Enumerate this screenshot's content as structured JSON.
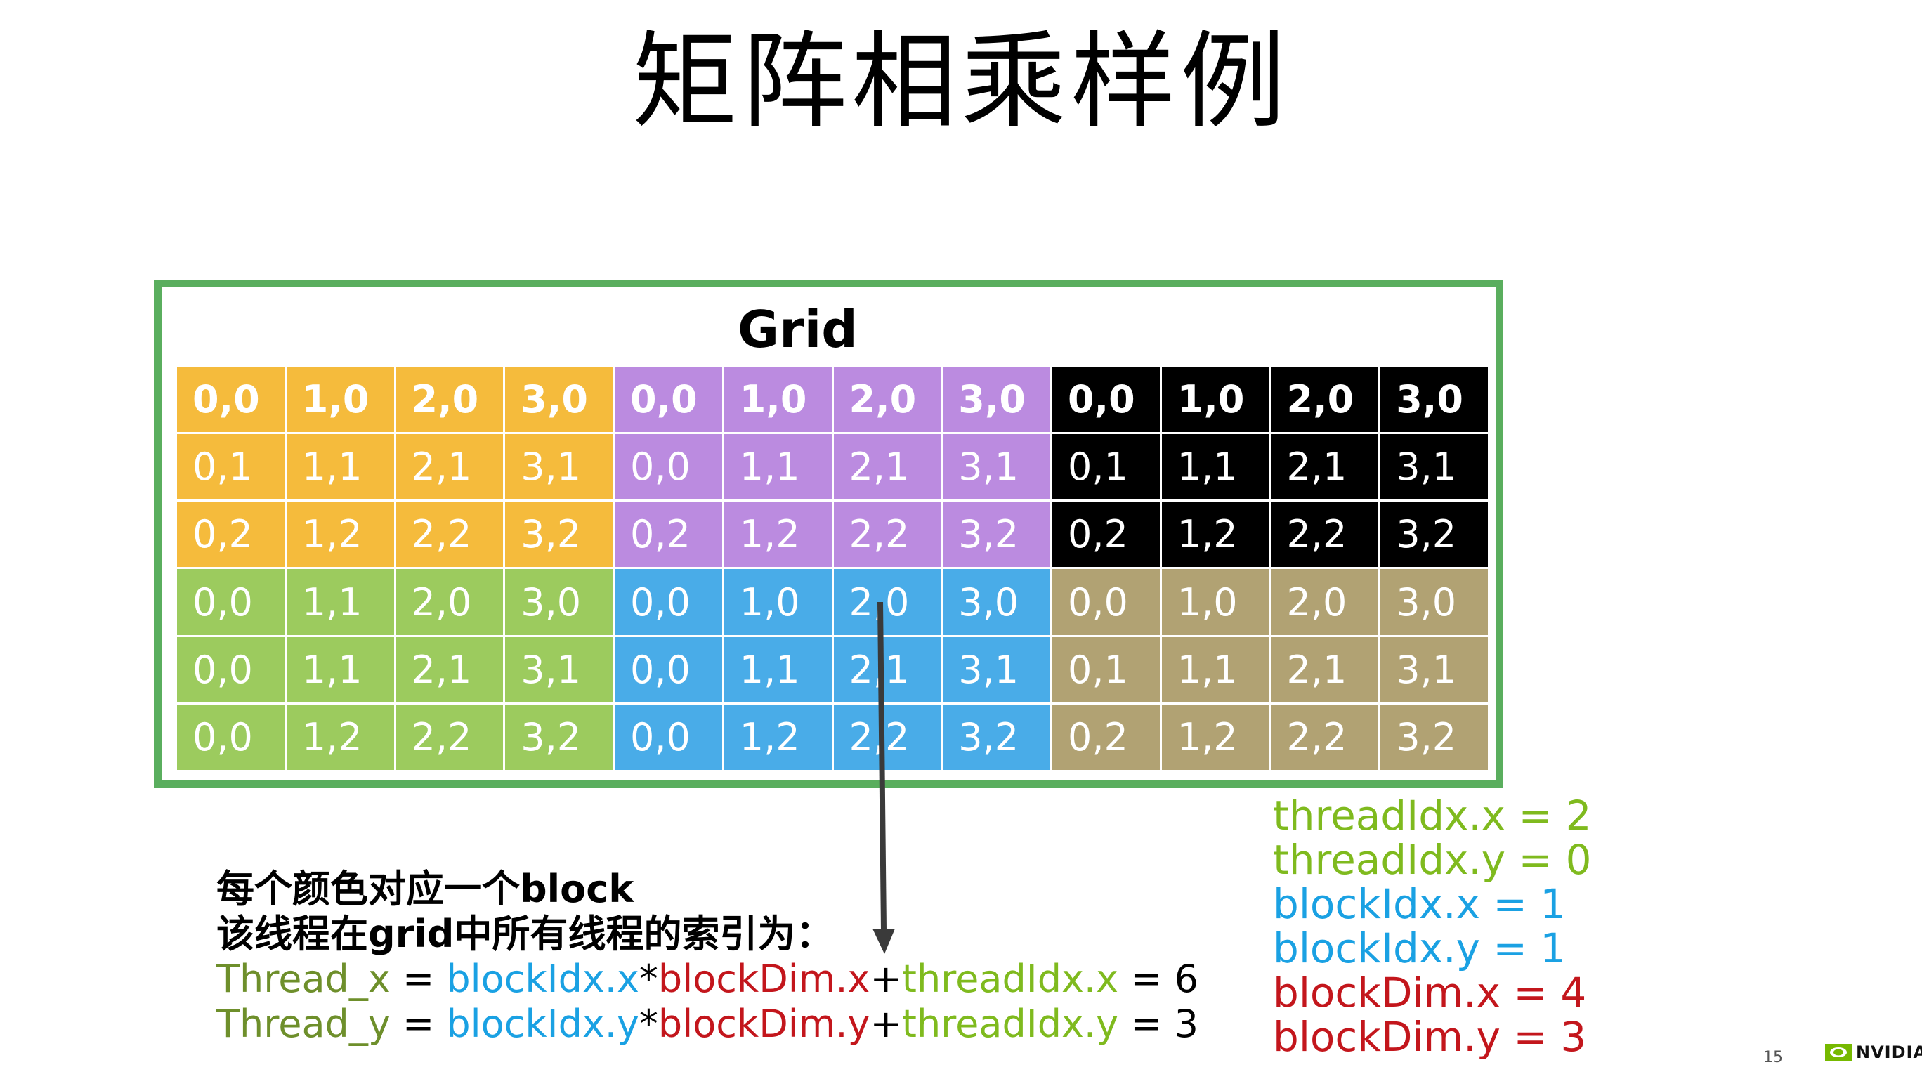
{
  "title": "矩阵相乘样例",
  "grid": {
    "label": "Grid",
    "rows": [
      [
        {
          "t": "0,0",
          "c": "#f5bb3c",
          "b": true
        },
        {
          "t": "1,0",
          "c": "#f5bb3c",
          "b": true
        },
        {
          "t": "2,0",
          "c": "#f5bb3c",
          "b": true
        },
        {
          "t": "3,0",
          "c": "#f5bb3c",
          "b": true
        },
        {
          "t": "0,0",
          "c": "#bb8be0",
          "b": true
        },
        {
          "t": "1,0",
          "c": "#bb8be0",
          "b": true
        },
        {
          "t": "2,0",
          "c": "#bb8be0",
          "b": true
        },
        {
          "t": "3,0",
          "c": "#bb8be0",
          "b": true
        },
        {
          "t": "0,0",
          "c": "#000000",
          "b": true
        },
        {
          "t": "1,0",
          "c": "#000000",
          "b": true
        },
        {
          "t": "2,0",
          "c": "#000000",
          "b": true
        },
        {
          "t": "3,0",
          "c": "#000000",
          "b": true
        }
      ],
      [
        {
          "t": "0,1",
          "c": "#f5bb3c"
        },
        {
          "t": "1,1",
          "c": "#f5bb3c"
        },
        {
          "t": "2,1",
          "c": "#f5bb3c"
        },
        {
          "t": "3,1",
          "c": "#f5bb3c"
        },
        {
          "t": "0,0",
          "c": "#bb8be0"
        },
        {
          "t": "1,1",
          "c": "#bb8be0"
        },
        {
          "t": "2,1",
          "c": "#bb8be0"
        },
        {
          "t": "3,1",
          "c": "#bb8be0"
        },
        {
          "t": "0,1",
          "c": "#000000"
        },
        {
          "t": "1,1",
          "c": "#000000"
        },
        {
          "t": "2,1",
          "c": "#000000"
        },
        {
          "t": "3,1",
          "c": "#000000"
        }
      ],
      [
        {
          "t": "0,2",
          "c": "#f5bb3c"
        },
        {
          "t": "1,2",
          "c": "#f5bb3c"
        },
        {
          "t": "2,2",
          "c": "#f5bb3c"
        },
        {
          "t": "3,2",
          "c": "#f5bb3c"
        },
        {
          "t": "0,2",
          "c": "#bb8be0"
        },
        {
          "t": "1,2",
          "c": "#bb8be0"
        },
        {
          "t": "2,2",
          "c": "#bb8be0"
        },
        {
          "t": "3,2",
          "c": "#bb8be0"
        },
        {
          "t": "0,2",
          "c": "#000000"
        },
        {
          "t": "1,2",
          "c": "#000000"
        },
        {
          "t": "2,2",
          "c": "#000000"
        },
        {
          "t": "3,2",
          "c": "#000000"
        }
      ],
      [
        {
          "t": "0,0",
          "c": "#9ccb5e"
        },
        {
          "t": "1,1",
          "c": "#9ccb5e"
        },
        {
          "t": "2,0",
          "c": "#9ccb5e"
        },
        {
          "t": "3,0",
          "c": "#9ccb5e"
        },
        {
          "t": "0,0",
          "c": "#49ace8"
        },
        {
          "t": "1,0",
          "c": "#49ace8"
        },
        {
          "t": "2,0",
          "c": "#49ace8"
        },
        {
          "t": "3,0",
          "c": "#49ace8"
        },
        {
          "t": "0,0",
          "c": "#b1a273"
        },
        {
          "t": "1,0",
          "c": "#b1a273"
        },
        {
          "t": "2,0",
          "c": "#b1a273"
        },
        {
          "t": "3,0",
          "c": "#b1a273"
        }
      ],
      [
        {
          "t": "0,0",
          "c": "#9ccb5e"
        },
        {
          "t": "1,1",
          "c": "#9ccb5e"
        },
        {
          "t": "2,1",
          "c": "#9ccb5e"
        },
        {
          "t": "3,1",
          "c": "#9ccb5e"
        },
        {
          "t": "0,0",
          "c": "#49ace8"
        },
        {
          "t": "1,1",
          "c": "#49ace8"
        },
        {
          "t": "2,1",
          "c": "#49ace8"
        },
        {
          "t": "3,1",
          "c": "#49ace8"
        },
        {
          "t": "0,1",
          "c": "#b1a273"
        },
        {
          "t": "1,1",
          "c": "#b1a273"
        },
        {
          "t": "2,1",
          "c": "#b1a273"
        },
        {
          "t": "3,1",
          "c": "#b1a273"
        }
      ],
      [
        {
          "t": "0,0",
          "c": "#9ccb5e"
        },
        {
          "t": "1,2",
          "c": "#9ccb5e"
        },
        {
          "t": "2,2",
          "c": "#9ccb5e"
        },
        {
          "t": "3,2",
          "c": "#9ccb5e"
        },
        {
          "t": "0,0",
          "c": "#49ace8"
        },
        {
          "t": "1,2",
          "c": "#49ace8"
        },
        {
          "t": "2,2",
          "c": "#49ace8"
        },
        {
          "t": "3,2",
          "c": "#49ace8"
        },
        {
          "t": "0,2",
          "c": "#b1a273"
        },
        {
          "t": "1,2",
          "c": "#b1a273"
        },
        {
          "t": "2,2",
          "c": "#b1a273"
        },
        {
          "t": "3,2",
          "c": "#b1a273"
        }
      ]
    ]
  },
  "explanation": {
    "line1": "每个颜色对应一个block",
    "line2": "该线程在grid中所有线程的索引为：",
    "formula_x": {
      "lhs": "Thread_x",
      "eq": " = ",
      "a": "blockIdx.x",
      "op1": "*",
      "b": "blockDim.x",
      "op2": "+",
      "c": "threadIdx.x",
      "result": " = 6"
    },
    "formula_y": {
      "lhs": "Thread_y",
      "eq": " = ",
      "a": "blockIdx.y",
      "op1": "*",
      "b": "blockDim.y",
      "op2": "+",
      "c": "threadIdx.y",
      "result": " = 3"
    }
  },
  "values": {
    "tix": "threadIdx.x = 2",
    "tiy": "threadIdx.y = 0",
    "bix": "blockIdx.x = 1",
    "biy": "blockIdx.y = 1",
    "bdx": "blockDim.x = 4",
    "bdy": "blockDim.y = 3"
  },
  "colors": {
    "border": "#5aae5e",
    "thread": "#7fba1e",
    "block_idx": "#1aa1e3",
    "block_dim": "#c3161c",
    "thread_label": "#6e8f2b",
    "arrow": "#3a3a3a"
  },
  "footer": {
    "page_number": "15",
    "logo_text": "NVIDIA"
  }
}
